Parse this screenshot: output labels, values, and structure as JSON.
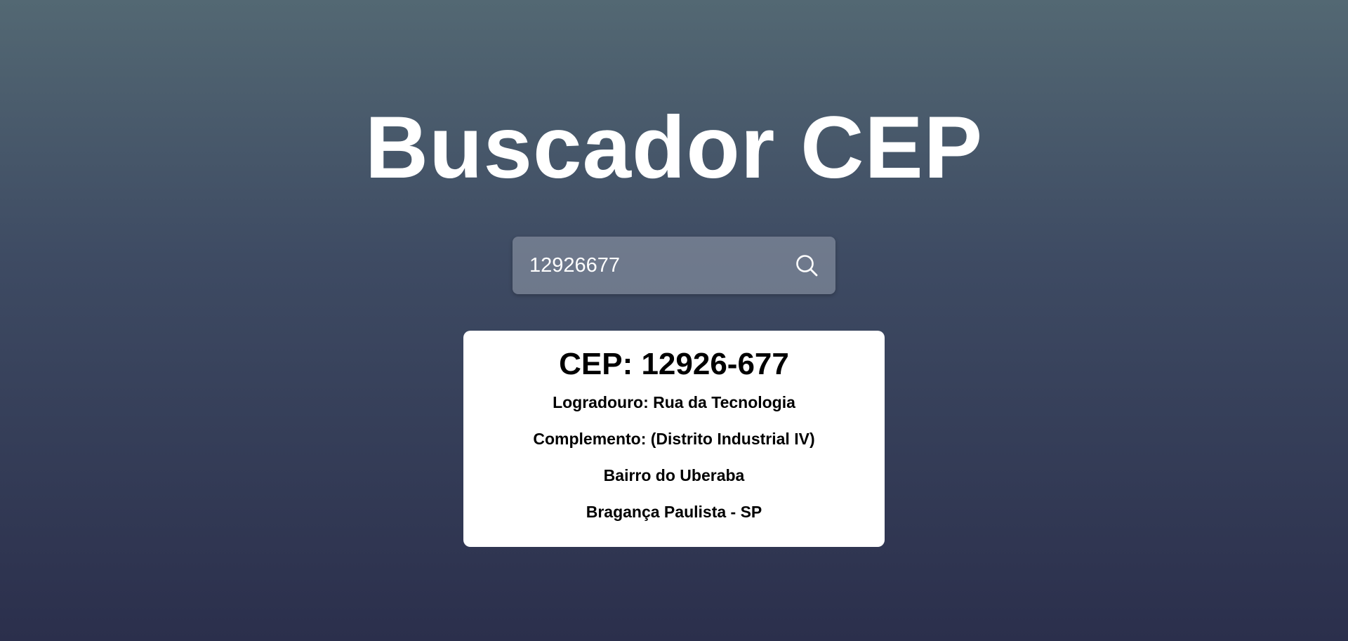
{
  "header": {
    "title": "Buscador CEP"
  },
  "search": {
    "value": "12926677",
    "icon": "search-icon"
  },
  "result": {
    "cep": "CEP: 12926-677",
    "logradouro": "Logradouro: Rua da Tecnologia",
    "complemento": "Complemento: (Distrito Industrial IV)",
    "bairro": "Bairro do Uberaba",
    "cidade_uf": "Bragança Paulista - SP"
  },
  "colors": {
    "background_top": "#536873",
    "background_bottom": "#2b2f4c",
    "card_background": "#ffffff",
    "title_text": "#ffffff"
  }
}
